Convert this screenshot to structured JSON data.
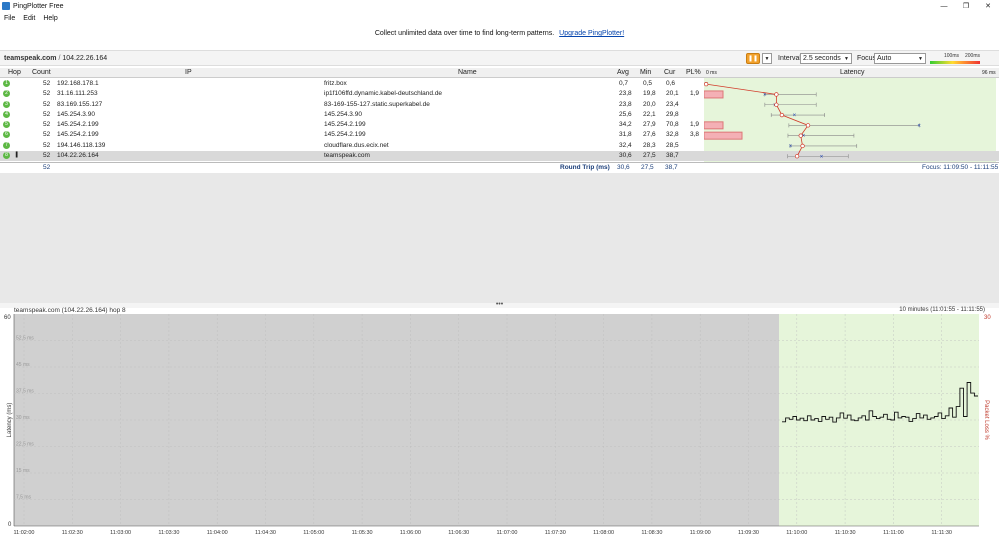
{
  "window": {
    "title": "PingPlotter Free",
    "controls": [
      "—",
      "❐",
      "✕"
    ]
  },
  "menu": [
    "File",
    "Edit",
    "Help"
  ],
  "banner": {
    "text": "Collect unlimited data over time to find long-term patterns.",
    "link": "Upgrade PingPlotter!"
  },
  "toolbar": {
    "target_host": "teamspeak.com",
    "target_sep": " / ",
    "target_ip": "104.22.26.164",
    "interval_label": "Interval",
    "interval_value": "2.5 seconds",
    "focus_label": "Focus",
    "focus_value": "Auto",
    "legend_low": "100ms",
    "legend_high": "200ms"
  },
  "columns": {
    "hop": "Hop",
    "count": "Count",
    "ip": "IP",
    "name": "Name",
    "avg": "Avg",
    "min": "Min",
    "cur": "Cur",
    "pl": "PL%",
    "latency": "Latency",
    "latency_min": "0 ms",
    "latency_max": "96 ms"
  },
  "hops": [
    {
      "hop": "1",
      "count": "52",
      "ip": "192.168.178.1",
      "name": "fritz.box",
      "avg": "0,7",
      "min": "0,5",
      "cur": "0,6",
      "pl": ""
    },
    {
      "hop": "2",
      "count": "52",
      "ip": "31.16.111.253",
      "name": "ip1f106ffd.dynamic.kabel-deutschland.de",
      "avg": "23,8",
      "min": "19,8",
      "cur": "20,1",
      "pl": "1,9"
    },
    {
      "hop": "3",
      "count": "52",
      "ip": "83.169.155.127",
      "name": "83-169-155-127.static.superkabel.de",
      "avg": "23,8",
      "min": "20,0",
      "cur": "23,4",
      "pl": ""
    },
    {
      "hop": "4",
      "count": "52",
      "ip": "145.254.3.90",
      "name": "145.254.3.90",
      "avg": "25,6",
      "min": "22,1",
      "cur": "29,8",
      "pl": ""
    },
    {
      "hop": "5",
      "count": "52",
      "ip": "145.254.2.199",
      "name": "145.254.2.199",
      "avg": "34,2",
      "min": "27,9",
      "cur": "70,8",
      "pl": "1,9"
    },
    {
      "hop": "6",
      "count": "52",
      "ip": "145.254.2.199",
      "name": "145.254.2.199",
      "avg": "31,8",
      "min": "27,6",
      "cur": "32,8",
      "pl": "3,8"
    },
    {
      "hop": "7",
      "count": "52",
      "ip": "194.146.118.139",
      "name": "cloudflare.dus.ecix.net",
      "avg": "32,4",
      "min": "28,3",
      "cur": "28,5",
      "pl": ""
    },
    {
      "hop": "8",
      "count": "52",
      "ip": "104.22.26.164",
      "name": "teamspeak.com",
      "avg": "30,6",
      "min": "27,5",
      "cur": "38,7",
      "pl": ""
    }
  ],
  "summary": {
    "count": "52",
    "label": "Round Trip (ms)",
    "avg": "30,6",
    "min": "27,5",
    "cur": "38,7",
    "focus": "Focus: 11:09:50 - 11:11:55"
  },
  "splitter_glyph": "•••",
  "graph": {
    "title": "teamspeak.com (104.22.26.164) hop 8",
    "range": "10 minutes (11:01:55 - 11:11:55)",
    "ylabel": "Latency (ms)",
    "y2label": "Packet Loss %",
    "ymax_label": "60",
    "ymin_label": "0",
    "y2max_label": "30",
    "grid_labels": [
      "52,5 ms",
      "45 ms",
      "37,5 ms",
      "30 ms",
      "22,5 ms",
      "15 ms",
      "7,5 ms"
    ],
    "time_labels": [
      "11:02:00",
      "11:02:30",
      "11:03:00",
      "11:03:30",
      "11:04:00",
      "11:04:30",
      "11:05:00",
      "11:05:30",
      "11:06:00",
      "11:06:30",
      "11:07:00",
      "11:07:30",
      "11:08:00",
      "11:08:30",
      "11:09:00",
      "11:09:30",
      "11:10:00",
      "11:10:30",
      "11:11:00",
      "11:11:30"
    ]
  },
  "chart_data": {
    "type": "line",
    "title": "teamspeak.com (104.22.26.164) hop 8",
    "xlabel": "",
    "ylabel": "Latency (ms)",
    "ylim": [
      0,
      60
    ],
    "y2label": "Packet Loss %",
    "y2lim": [
      0,
      30
    ],
    "x_range": [
      "11:01:55",
      "11:11:55"
    ],
    "focus_range": [
      "11:09:50",
      "11:11:55"
    ],
    "series": [
      {
        "values": [
          29.5,
          30.6,
          30.2,
          31.0,
          30.0,
          30.5,
          29.8,
          31.2,
          30.0,
          30.4,
          29.6,
          31.0,
          30.2,
          30.8,
          29.4,
          30.6,
          32.0,
          30.5,
          31.4,
          30.0,
          29.8,
          30.6,
          31.2,
          30.0,
          32.6,
          31.0,
          30.4,
          30.8,
          31.6,
          30.2,
          30.0,
          32.2,
          30.6,
          31.0,
          30.8,
          29.6,
          30.4,
          31.8,
          30.6,
          31.4,
          30.2,
          30.6,
          31.0,
          32.0,
          30.4,
          31.2,
          33.4,
          30.8,
          33.8,
          39.0,
          31.0,
          40.6,
          37.6,
          36.8
        ]
      }
    ],
    "focus_color": "#e6f5da",
    "history_color": "#d0d0d0"
  }
}
